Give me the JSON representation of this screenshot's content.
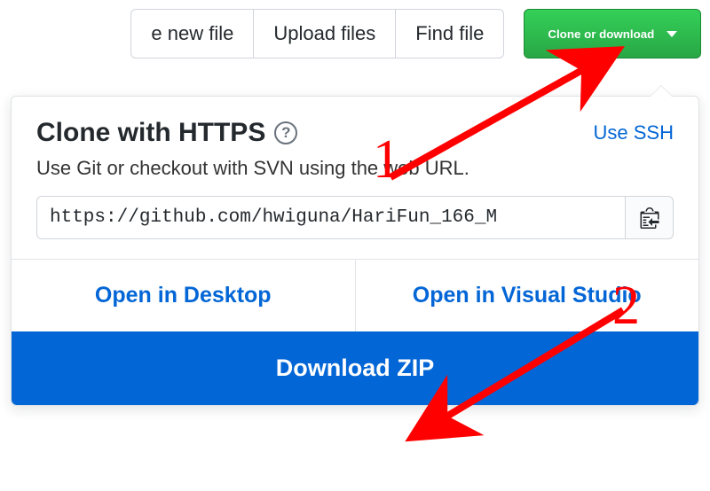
{
  "toolbar": {
    "new_file": "e new file",
    "upload": "Upload files",
    "find": "Find file",
    "clone": "Clone or download"
  },
  "popover": {
    "title": "Clone with HTTPS",
    "use_ssh": "Use SSH",
    "subtext": "Use Git or checkout with SVN using the web URL.",
    "url": "https://github.com/hwiguna/HariFun_166_M",
    "open_desktop": "Open in Desktop",
    "open_vs": "Open in Visual Studio",
    "download_zip": "Download ZIP"
  },
  "annotations": {
    "one": "1",
    "two": "2"
  }
}
